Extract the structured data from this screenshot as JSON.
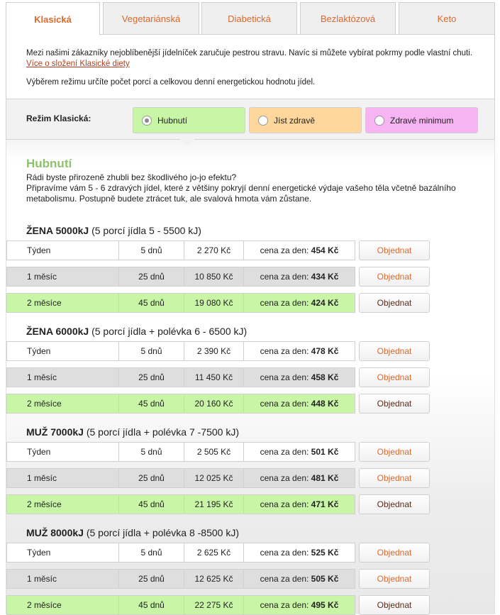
{
  "tabs": [
    {
      "label": "Klasická",
      "active": true
    },
    {
      "label": "Vegetariánská",
      "active": false
    },
    {
      "label": "Diabetická",
      "active": false
    },
    {
      "label": "Bezlaktózová",
      "active": false
    },
    {
      "label": "Keto",
      "active": false
    }
  ],
  "intro": {
    "text1": "Mezi našimi zákazníky nejoblíbenější jídelníček zaručuje pestrou stravu. Navíc si můžete vybírat pokrmy podle vlastní chuti.",
    "link": "Více o složení Klasické diety",
    "text2": "Výběrem režimu určíte počet porcí a celkovou denní energetickou hodnotu jídel."
  },
  "mode": {
    "label": "Režim Klasická:",
    "options": [
      {
        "label": "Hubnutí",
        "color": "#c9f5a6",
        "selected": true
      },
      {
        "label": "Jíst zdravě",
        "color": "#ffd69b",
        "selected": false
      },
      {
        "label": "Zdravé minimum",
        "color": "#f6b4f2",
        "selected": false
      }
    ]
  },
  "content": {
    "title": "Hubnutí",
    "desc1": "Rádi byste přirozeně zhubli bez škodlivého jo-jo efektu?",
    "desc2": "Připravíme vám 5 - 6 zdravých jídel, které z většiny pokryjí denní energetické výdaje vašeho těla včetně bazálního metabolismu. Postupně budete ztrácet tuk, ale svalová hmota vám zůstane."
  },
  "order_label": "Objednat",
  "daily_prefix": "cena za den:",
  "sections": [
    {
      "title_bold": "ŽENA 5000kJ",
      "title_rest": "(5 porcí jídla 5 - 5500 kJ)",
      "rows": [
        {
          "period": "Týden",
          "days": "5 dnů",
          "price": "2 270 Kč",
          "daily": "454 Kč"
        },
        {
          "period": "1 měsíc",
          "days": "25 dnů",
          "price": "10 850 Kč",
          "daily": "434 Kč"
        },
        {
          "period": "2 měsíce",
          "days": "45 dnů",
          "price": "19 080 Kč",
          "daily": "424 Kč"
        }
      ]
    },
    {
      "title_bold": "ŽENA 6000kJ",
      "title_rest": "(5 porcí jídla + polévka 6 - 6500 kJ)",
      "rows": [
        {
          "period": "Týden",
          "days": "5 dnů",
          "price": "2 390 Kč",
          "daily": "478 Kč"
        },
        {
          "period": "1 měsíc",
          "days": "25 dnů",
          "price": "11 450 Kč",
          "daily": "458 Kč"
        },
        {
          "period": "2 měsíce",
          "days": "45 dnů",
          "price": "20 160 Kč",
          "daily": "448 Kč"
        }
      ]
    },
    {
      "title_bold": "MUŽ 7000kJ",
      "title_rest": "(5 porcí jídla + polévka 7 -7500 kJ)",
      "rows": [
        {
          "period": "Týden",
          "days": "5 dnů",
          "price": "2 505 Kč",
          "daily": "501 Kč"
        },
        {
          "period": "1 měsíc",
          "days": "25 dnů",
          "price": "12 025 Kč",
          "daily": "481 Kč"
        },
        {
          "period": "2 měsíce",
          "days": "45 dnů",
          "price": "21 195 Kč",
          "daily": "471 Kč"
        }
      ]
    },
    {
      "title_bold": "MUŽ 8000kJ",
      "title_rest": "(5 porcí jídla + polévka 8 -8500 kJ)",
      "rows": [
        {
          "period": "Týden",
          "days": "5 dnů",
          "price": "2 625 Kč",
          "daily": "525 Kč"
        },
        {
          "period": "1 měsíc",
          "days": "25 dnů",
          "price": "12 625 Kč",
          "daily": "505 Kč"
        },
        {
          "period": "2 měsíce",
          "days": "45 dnů",
          "price": "22 275 Kč",
          "daily": "495 Kč"
        }
      ]
    }
  ]
}
